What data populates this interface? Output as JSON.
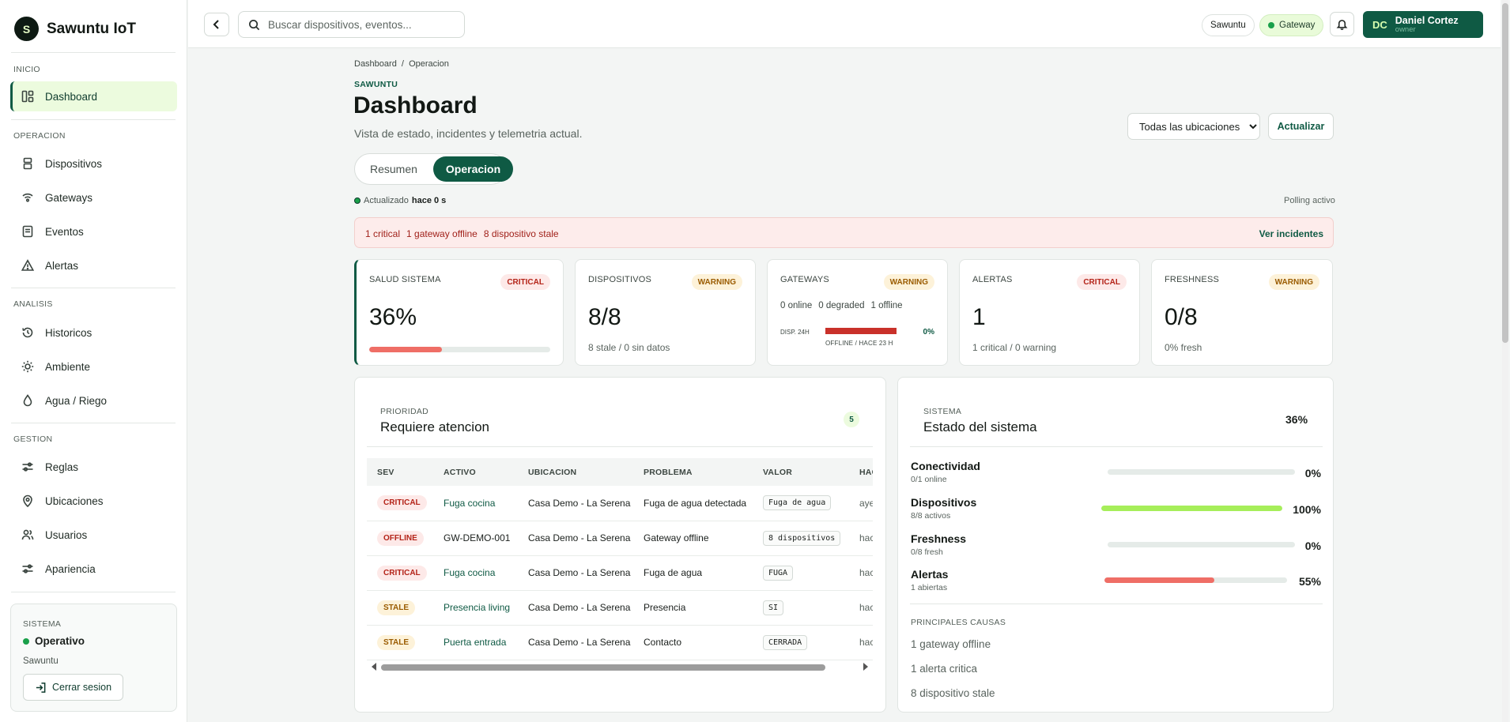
{
  "brand": {
    "initial": "S",
    "name": "Sawuntu IoT"
  },
  "nav": {
    "sections": [
      {
        "label": "INICIO",
        "items": [
          {
            "label": "Dashboard",
            "icon": "dashboard-icon",
            "active": true
          }
        ]
      },
      {
        "label": "OPERACION",
        "items": [
          {
            "label": "Dispositivos",
            "icon": "devices-icon"
          },
          {
            "label": "Gateways",
            "icon": "gateway-icon"
          },
          {
            "label": "Eventos",
            "icon": "events-icon"
          },
          {
            "label": "Alertas",
            "icon": "alert-icon"
          }
        ]
      },
      {
        "label": "ANALISIS",
        "items": [
          {
            "label": "Historicos",
            "icon": "history-icon"
          },
          {
            "label": "Ambiente",
            "icon": "sun-icon"
          },
          {
            "label": "Agua / Riego",
            "icon": "water-drop-icon"
          }
        ]
      },
      {
        "label": "GESTION",
        "items": [
          {
            "label": "Reglas",
            "icon": "sliders-icon"
          },
          {
            "label": "Ubicaciones",
            "icon": "location-icon"
          },
          {
            "label": "Usuarios",
            "icon": "users-icon"
          },
          {
            "label": "Apariencia",
            "icon": "sliders-icon"
          }
        ]
      }
    ]
  },
  "system_card": {
    "label": "SISTEMA",
    "status": "Operativo",
    "tenant": "Sawuntu",
    "logout": "Cerrar sesion"
  },
  "topbar": {
    "search_placeholder": "Buscar dispositivos, eventos...",
    "tenant_pill": "Sawuntu",
    "gateway_pill": "Gateway",
    "user": {
      "initials": "DC",
      "name": "Daniel Cortez",
      "role": "owner"
    }
  },
  "page": {
    "breadcrumb": "Dashboard  /  Operacion",
    "eyebrow": "SAWUNTU",
    "title": "Dashboard",
    "subtitle": "Vista de estado, incidentes y telemetria actual.",
    "location_select": "Todas las ubicaciones",
    "refresh": "Actualizar",
    "tabs": [
      {
        "label": "Resumen",
        "active": false
      },
      {
        "label": "Operacion",
        "active": true
      }
    ],
    "updated_prefix": "Actualizado",
    "updated_value": "hace 0 s",
    "polling": "Polling activo"
  },
  "alert_bar": {
    "items": [
      "1 critical",
      "1 gateway offline",
      "8 dispositivo stale"
    ],
    "link": "Ver incidentes"
  },
  "kpis": {
    "salud": {
      "label": "SALUD SISTEMA",
      "badge": "CRITICAL",
      "value": "36%",
      "progress": 0.4
    },
    "dispositivos": {
      "label": "DISPOSITIVOS",
      "badge": "WARNING",
      "value": "8/8",
      "sub": "8 stale / 0 sin datos"
    },
    "gateways": {
      "label": "GATEWAYS",
      "badge": "WARNING",
      "online": "0 online",
      "degraded": "0 degraded",
      "offline": "1 offline",
      "disp": "DISP. 24H",
      "pct": "0%",
      "off_label": "OFFLINE / HACE 23 H"
    },
    "alertas": {
      "label": "ALERTAS",
      "badge": "CRITICAL",
      "value": "1",
      "sub": "1 critical / 0 warning"
    },
    "freshness": {
      "label": "FRESHNESS",
      "badge": "WARNING",
      "value": "0/8",
      "sub": "0% fresh"
    }
  },
  "priority": {
    "eyebrow": "PRIORIDAD",
    "title": "Requiere atencion",
    "count": "5",
    "columns": [
      "SEV",
      "ACTIVO",
      "UBICACION",
      "PROBLEMA",
      "VALOR",
      "HACE"
    ],
    "rows": [
      {
        "sev": "CRITICAL",
        "sev_class": "critical",
        "asset": "Fuga cocina",
        "asset_link": true,
        "location": "Casa Demo - La Serena",
        "problem": "Fuga de agua detectada",
        "value": "Fuga de agua",
        "ago": "ayer"
      },
      {
        "sev": "OFFLINE",
        "sev_class": "offline",
        "asset": "GW-DEMO-001",
        "asset_link": false,
        "location": "Casa Demo - La Serena",
        "problem": "Gateway offline",
        "value": "8 dispositivos",
        "ago": "hace"
      },
      {
        "sev": "CRITICAL",
        "sev_class": "critical",
        "asset": "Fuga cocina",
        "asset_link": true,
        "location": "Casa Demo - La Serena",
        "problem": "Fuga de agua",
        "value": "FUGA",
        "ago": "hace"
      },
      {
        "sev": "STALE",
        "sev_class": "stale",
        "asset": "Presencia living",
        "asset_link": true,
        "location": "Casa Demo - La Serena",
        "problem": "Presencia",
        "value": "SI",
        "ago": "hace"
      },
      {
        "sev": "STALE",
        "sev_class": "stale",
        "asset": "Puerta entrada",
        "asset_link": true,
        "location": "Casa Demo - La Serena",
        "problem": "Contacto",
        "value": "CERRADA",
        "ago": "hace"
      }
    ]
  },
  "system_state": {
    "eyebrow": "SISTEMA",
    "title": "Estado del sistema",
    "pct": "36%",
    "metrics": [
      {
        "name": "Conectividad",
        "sub": "0/1 online",
        "value": "0%",
        "level": 0,
        "color": "#d8e0dc"
      },
      {
        "name": "Dispositivos",
        "sub": "8/8 activos",
        "value": "100%",
        "level": 1,
        "color": "#a6ee5a"
      },
      {
        "name": "Freshness",
        "sub": "0/8 fresh",
        "value": "0%",
        "level": 0,
        "color": "#d8e0dc"
      },
      {
        "name": "Alertas",
        "sub": "1 abiertas",
        "value": "55%",
        "level": 0.6,
        "color": "#ef6e66"
      }
    ],
    "causes_label": "PRINCIPALES CAUSAS",
    "causes": [
      "1 gateway offline",
      "1 alerta critica",
      "8 dispositivo stale"
    ]
  },
  "colors": {
    "brand": "#0f5a44",
    "accent_green": "#a6ee5a",
    "critical": "#b42318",
    "warning": "#9a5b00"
  }
}
